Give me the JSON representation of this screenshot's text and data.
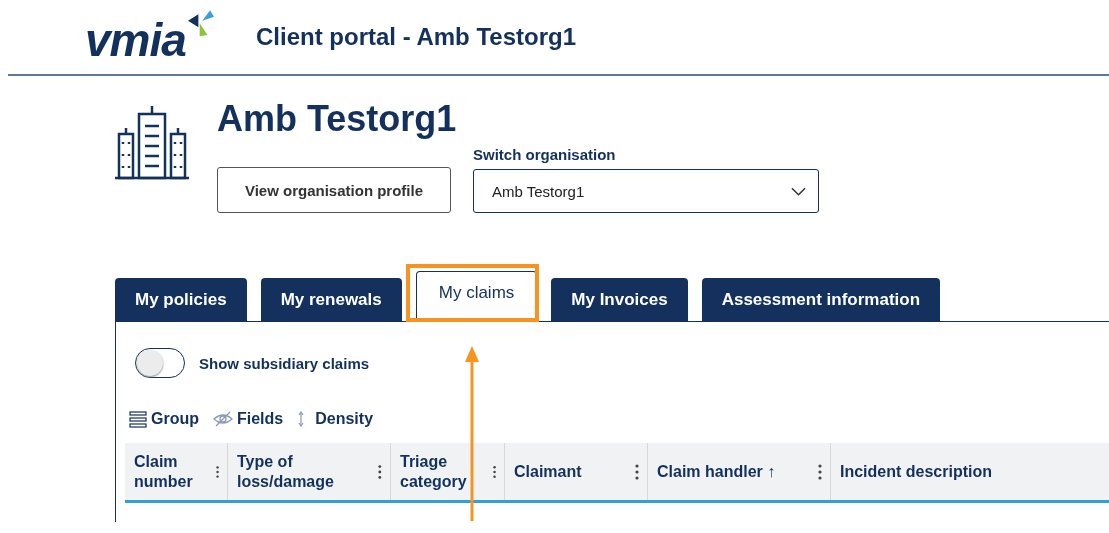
{
  "header": {
    "logo": "vmia",
    "title": "Client portal - Amb Testorg1"
  },
  "organisation": {
    "name": "Amb Testorg1",
    "profile_button": "View organisation profile",
    "switch_label": "Switch organisation",
    "switch_value": "Amb Testorg1"
  },
  "tabs": [
    {
      "label": "My policies",
      "selected": false
    },
    {
      "label": "My renewals",
      "selected": false
    },
    {
      "label": "My claims",
      "selected": true
    },
    {
      "label": "My Invoices",
      "selected": false
    },
    {
      "label": "Assessment information",
      "selected": false
    }
  ],
  "subsidiary_toggle": {
    "label": "Show subsidiary claims",
    "on": false
  },
  "toolbar": [
    {
      "label": "Group",
      "kind": "group"
    },
    {
      "label": "Fields",
      "kind": "fields"
    },
    {
      "label": "Density",
      "kind": "density"
    }
  ],
  "table": {
    "columns": [
      {
        "label": "Claim number",
        "menu": true
      },
      {
        "label": "Type of loss/damage",
        "menu": true
      },
      {
        "label": "Triage category",
        "menu": true
      },
      {
        "label": "Claimant",
        "menu": true
      },
      {
        "label": "Claim handler ↑",
        "menu": true
      },
      {
        "label": "Incident description",
        "menu": false
      }
    ]
  },
  "annotation": {
    "kind": "highlight"
  }
}
